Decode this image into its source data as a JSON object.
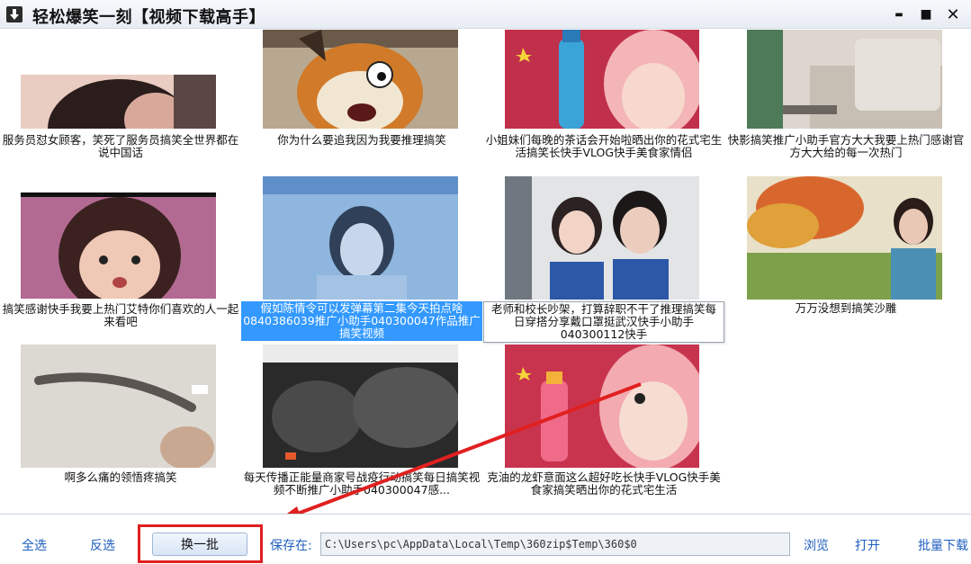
{
  "window": {
    "title": "轻松爆笑一刻【视频下载高手】",
    "controls": {
      "minimize": "▬",
      "maximize": "■",
      "close": "✕"
    }
  },
  "videos": [
    {
      "caption": "服务员怼女顾客，笑死了服务员搞笑全世界都在说中国话",
      "state": "normal"
    },
    {
      "caption": "你为什么要追我因为我要推理搞笑",
      "state": "normal"
    },
    {
      "caption": "小姐妹们每晚的茶话会开始啦晒出你的花式宅生活搞笑长快手VLOG快手美食家情侣",
      "state": "normal"
    },
    {
      "caption": "快影搞笑推广小助手官方大大我要上热门感谢官方大大给的每一次热门",
      "state": "normal"
    },
    {
      "caption": "搞笑感谢快手我要上热门艾特你们喜欢的人一起来看吧",
      "state": "normal"
    },
    {
      "caption": "假如陈情令可以发弹幕第二集今天拍点啥0840386039推广小助手040300047作品推广搞笑视频",
      "state": "selected"
    },
    {
      "caption": "老师和校长吵架，打算辞职不干了推理搞笑每日穿搭分享戴口罩挺武汉快手小助手040300112快手",
      "state": "hovered"
    },
    {
      "caption": "万万没想到搞笑沙雕",
      "state": "normal"
    },
    {
      "caption": "啊多么痛的领悟疼搞笑",
      "state": "normal"
    },
    {
      "caption": "每天传播正能量商家号战疫行动搞笑每日搞笑视频不断推广小助手040300047感...",
      "state": "normal"
    },
    {
      "caption": "克油的龙虾意面这么超好吃长快手VLOG快手美食家搞笑晒出你的花式宅生活",
      "state": "normal"
    }
  ],
  "toolbar": {
    "select_all": "全选",
    "invert": "反选",
    "next_batch": "换一批",
    "save_label": "保存在:",
    "save_path": "C:\\Users\\pc\\AppData\\Local\\Temp\\360zip$Temp\\360$0",
    "browse": "浏览",
    "open": "打开",
    "batch_download": "批量下载"
  },
  "colors": {
    "selection": "#3399ff",
    "annotation": "#e02020",
    "link": "#1f5fbf"
  }
}
